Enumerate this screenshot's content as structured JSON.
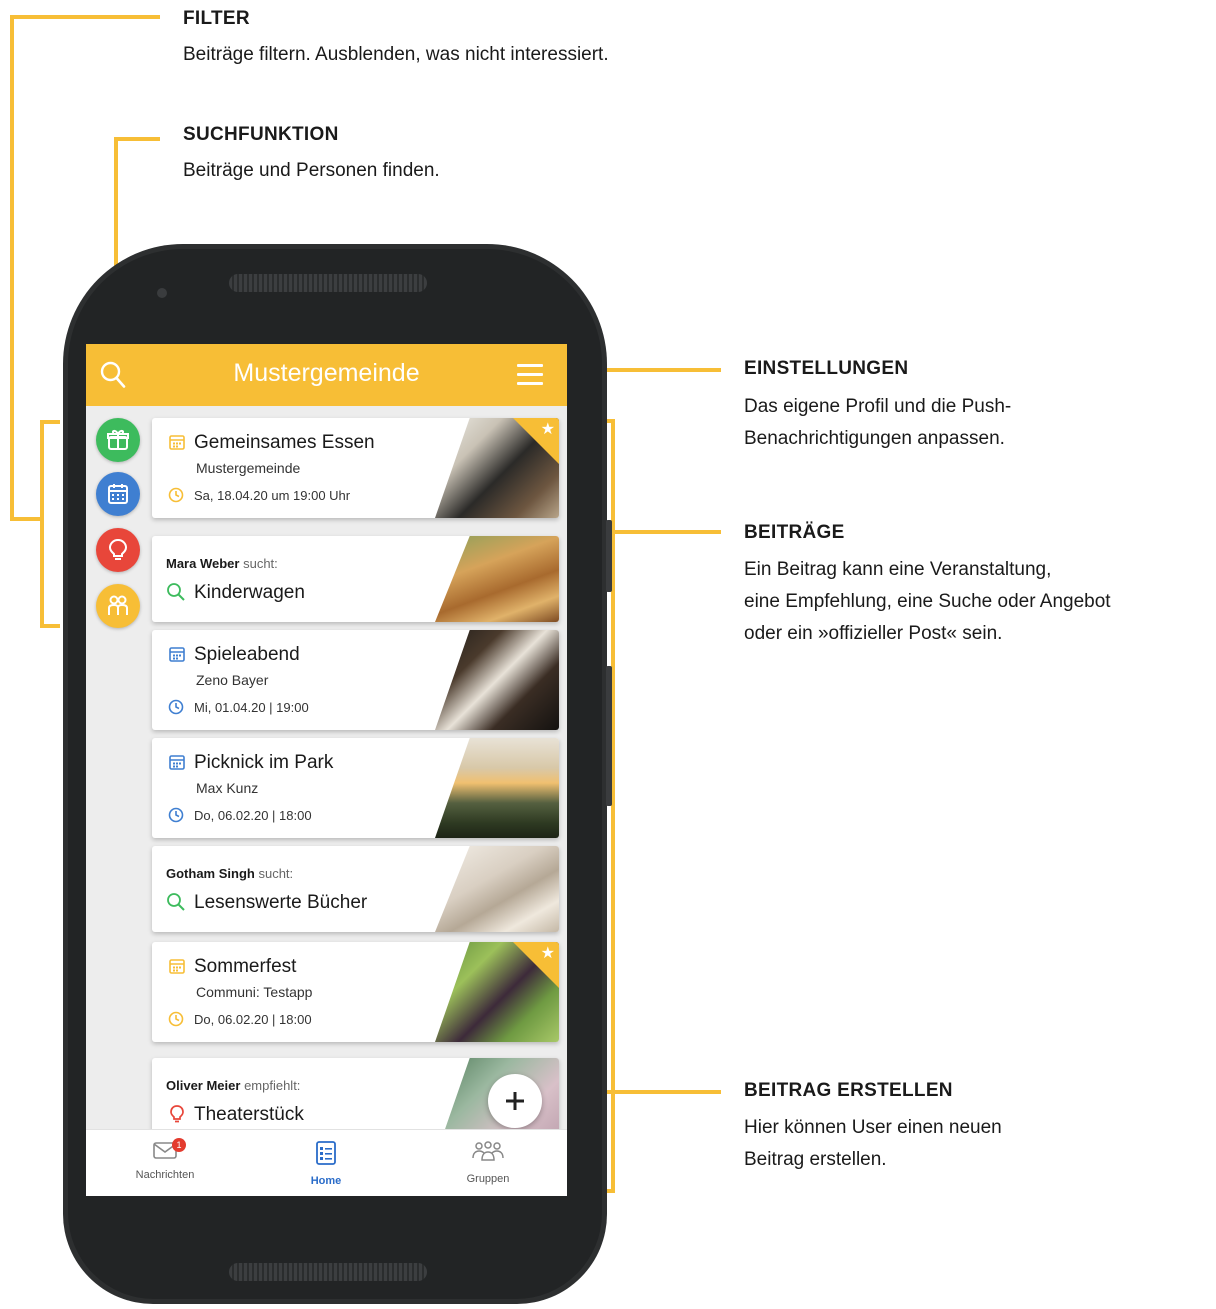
{
  "annotations": {
    "filter": {
      "title": "FILTER",
      "desc": "Beiträge filtern. Ausblenden, was nicht interessiert."
    },
    "search": {
      "title": "SUCHFUNKTION",
      "desc": "Beiträge und Personen finden."
    },
    "settings": {
      "title": "EINSTELLUNGEN",
      "desc1": "Das eigene Profil und die Push-",
      "desc2": "Benachrichtigungen anpassen."
    },
    "posts": {
      "title": "BEITRÄGE",
      "desc1": "Ein Beitrag kann eine Veranstaltung,",
      "desc2": "eine Empfehlung, eine Suche oder Angebot",
      "desc3": "oder ein »offizieller Post« sein."
    },
    "create": {
      "title": "BEITRAG ERSTELLEN",
      "desc1": "Hier können User einen neuen",
      "desc2": "Beitrag erstellen."
    }
  },
  "app": {
    "title": "Mustergemeinde",
    "cards": [
      {
        "title": "Gemeinsames Essen",
        "sub": "Mustergemeinde",
        "date": "Sa, 18.04.20 um 19:00 Uhr"
      },
      {
        "who": "Mara Weber",
        "verb": "sucht:",
        "title": "Kinderwagen"
      },
      {
        "title": "Spieleabend",
        "sub": "Zeno Bayer",
        "date": "Mi, 01.04.20 | 19:00"
      },
      {
        "title": "Picknick im Park",
        "sub": "Max Kunz",
        "date": "Do, 06.02.20 | 18:00"
      },
      {
        "who": "Gotham Singh",
        "verb": "sucht:",
        "title": "Lesenswerte Bücher"
      },
      {
        "title": "Sommerfest",
        "sub": "Communi: Testapp",
        "date": "Do, 06.02.20 | 18:00"
      },
      {
        "who": "Oliver Meier",
        "verb": "empfiehlt:",
        "title": "Theaterstück"
      }
    ],
    "nav": {
      "messages": "Nachrichten",
      "messages_badge": "1",
      "home": "Home",
      "groups": "Gruppen"
    }
  },
  "colors": {
    "accent": "#f7be36",
    "green": "#3dbb5d",
    "blue": "#3f7fd1",
    "red": "#e8463a",
    "active_nav": "#2a6cc9"
  },
  "icons": [
    "search-icon",
    "menu-icon",
    "gift-icon",
    "calendar-icon",
    "lightbulb-icon",
    "people-icon",
    "clock-icon",
    "star-icon",
    "plus-icon",
    "mail-icon",
    "list-icon"
  ]
}
